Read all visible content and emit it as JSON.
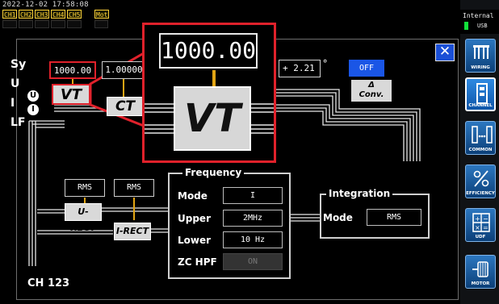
{
  "status": {
    "datetime": "2022-12-02 17:58:08",
    "channels": [
      "CH1",
      "CH2",
      "CH3",
      "CH4",
      "CH5"
    ],
    "mode_chip": "Mot",
    "accent_yellow": "#ffd23a"
  },
  "sidebar": {
    "storage_label": "Internal",
    "usb_label": "USB",
    "items": [
      {
        "label": "WIRING",
        "icon": "wiring-icon"
      },
      {
        "label": "CHANNEL",
        "icon": "channel-icon",
        "active": true
      },
      {
        "label": "COMMON",
        "icon": "common-icon"
      },
      {
        "label": "EFFICIENCY",
        "icon": "efficiency-icon"
      },
      {
        "label": "UDF",
        "icon": "udf-icon"
      },
      {
        "label": "MOTOR",
        "icon": "motor-icon"
      }
    ]
  },
  "dialog": {
    "close_label": "✕",
    "channel_label": "CH 123",
    "left_fragments": [
      "Sy",
      "U",
      "I",
      "LF"
    ],
    "voltage_ratio": "1000.00",
    "current_ratio": "1.00000",
    "phase_correction": "+ 2.21",
    "phase_unit": "°",
    "vt_label": "VT",
    "ct_label": "CT",
    "u_marker": "U",
    "i_marker": "I",
    "delta_conv_button": "OFF",
    "delta_conv_symbol": "Δ",
    "delta_conv_label": "Conv.",
    "u_rect_mode": "RMS",
    "i_rect_mode": "RMS",
    "u_rect_label": "U-RECT",
    "i_rect_label": "I-RECT",
    "frequency": {
      "title": "Frequency",
      "mode_label": "Mode",
      "mode_value": "I",
      "upper_label": "Upper",
      "upper_value": "2MHz",
      "lower_label": "Lower",
      "lower_value": "10 Hz",
      "zc_hpf_label": "ZC HPF",
      "zc_hpf_value": "ON"
    },
    "integration": {
      "title": "Integration",
      "mode_label": "Mode",
      "mode_value": "RMS"
    }
  },
  "magnifier": {
    "value": "1000.00",
    "label": "VT",
    "border_color": "#e0212b"
  }
}
